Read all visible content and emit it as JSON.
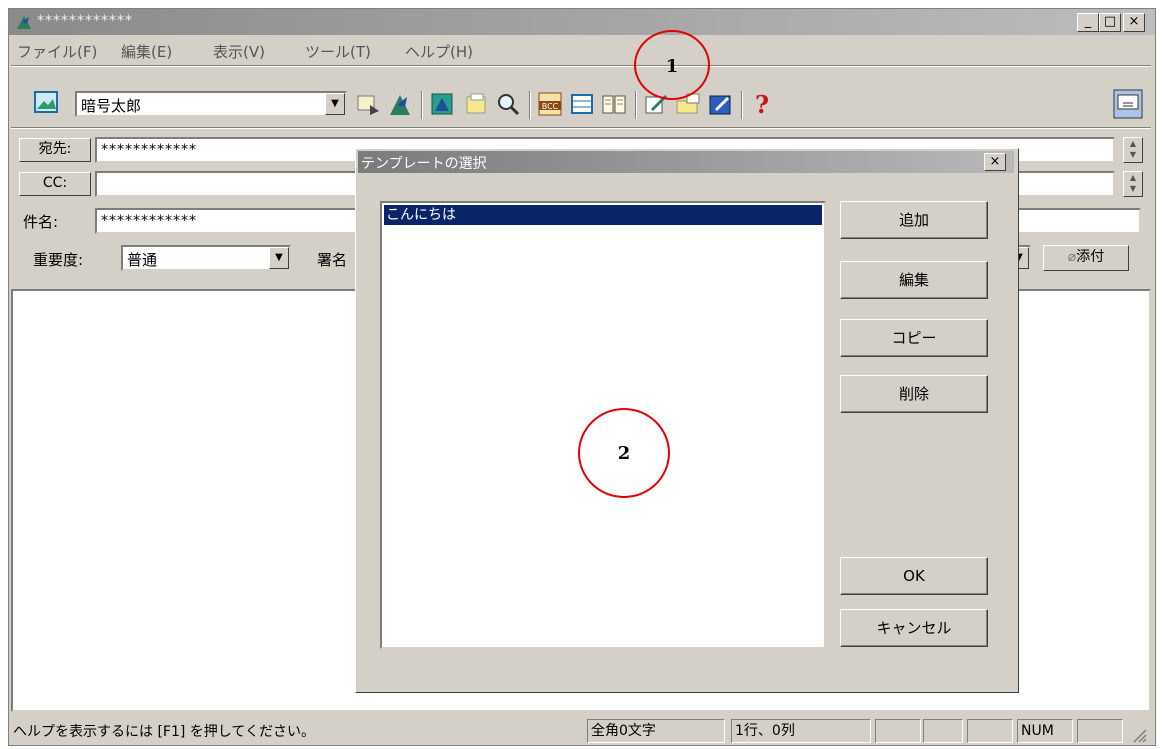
{
  "window": {
    "title": "************",
    "controls": [
      "_",
      "□",
      "×"
    ]
  },
  "menu": [
    "ファイル(F)",
    "編集(E)",
    "表示(V)",
    "ツール(T)",
    "ヘルプ(H)"
  ],
  "toolbar": {
    "account": "暗号太郎",
    "icons": [
      "account-icon",
      "send-icon",
      "receive-icon",
      "compose-icon",
      "note-icon",
      "search-icon",
      "bcc-icon",
      "envelope-icon",
      "addressbook-icon",
      "edit-icon",
      "folder-icon",
      "sign-icon",
      "help-icon",
      "screen-icon"
    ]
  },
  "header": {
    "to_label": "宛先:",
    "to_value": "************",
    "cc_label": "CC:",
    "cc_value": "",
    "subject_label": "件名:",
    "subject_value": "************",
    "priority_label": "重要度:",
    "priority_value": "普通",
    "signature_label": "署名",
    "attach_label": "添付"
  },
  "status": {
    "help": "ヘルプを表示するには [F1] を押してください。",
    "chars": "全角0文字",
    "position": "1行、0列",
    "num": "NUM"
  },
  "dialog": {
    "title": "テンプレートの選択",
    "close": "×",
    "items": [
      "こんにちは"
    ],
    "buttons": {
      "add": "追加",
      "edit": "編集",
      "copy": "コピー",
      "delete": "削除",
      "ok": "OK",
      "cancel": "キャンセル"
    }
  },
  "annotations": [
    "1",
    "2"
  ],
  "colors": {
    "accent_annotation": "#e00000",
    "selection": "#0a246a"
  }
}
